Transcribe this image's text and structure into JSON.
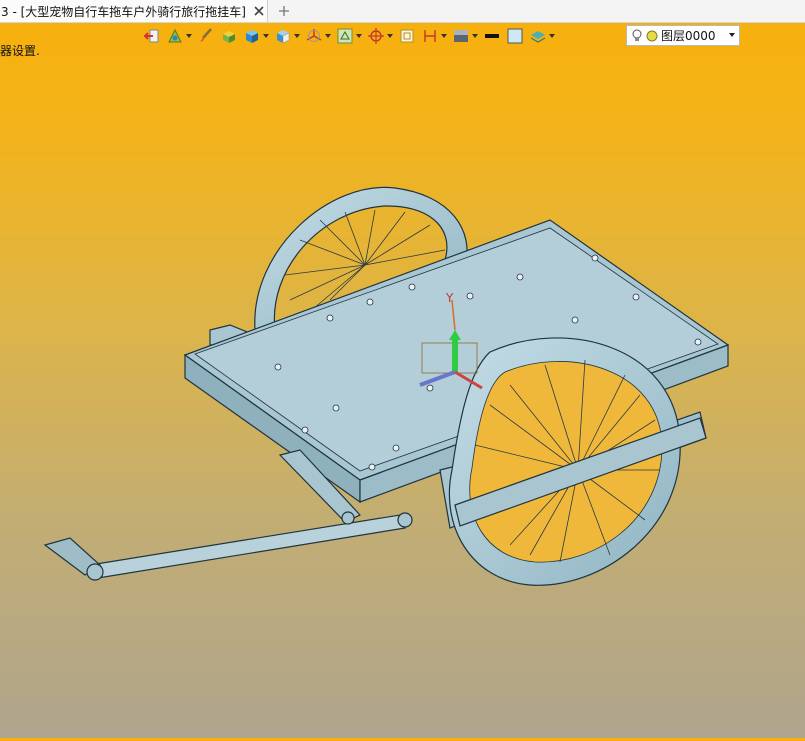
{
  "tab": {
    "title": "3 - [大型宠物自行车拖车户外骑行旅行拖挂车]",
    "close_icon": "close-icon",
    "add_icon": "plus-icon"
  },
  "toolbar": {
    "icons": [
      "exit-sketch-icon",
      "view-arrow-icon",
      "brush-icon",
      "render-style-icon",
      "solid-cube-icon",
      "display-cube-icon",
      "axis-view-icon",
      "wireframe-view-icon",
      "snap-target-icon",
      "frame-icon",
      "dimension-icon",
      "shading-icon",
      "line-color-icon",
      "fill-color-icon",
      "layers-icon"
    ],
    "layer": {
      "bulb_icon": "lightbulb-icon",
      "color_icon": "layer-color-icon",
      "value": "图层0000"
    }
  },
  "status_text": "器设置.",
  "viewport": {
    "model": "bicycle-trailer-3d-model",
    "triad": {
      "y_label": "Y"
    },
    "colors": {
      "part": "#a8c5d0",
      "edge": "#1e3440",
      "axis_y": "#2ecc40"
    }
  }
}
